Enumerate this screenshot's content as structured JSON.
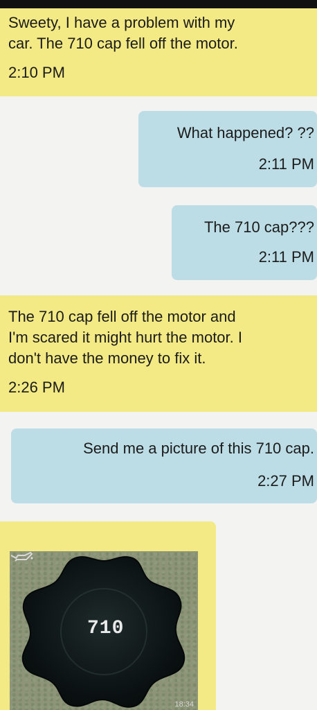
{
  "messages": [
    {
      "direction": "received",
      "text": "Sweety, I have a problem with my\ncar. The 710 cap fell off the motor.",
      "time": "2:10 PM"
    },
    {
      "direction": "sent",
      "text": "What happened? ??",
      "time": "2:11 PM"
    },
    {
      "direction": "sent",
      "text": "The 710 cap???",
      "time": "2:11 PM"
    },
    {
      "direction": "received",
      "text": "The 710 cap fell off the motor and\nI'm scared it might hurt the motor. I\ndon't have the money to fix it.",
      "time": "2:26 PM"
    },
    {
      "direction": "sent",
      "text": "Send me a picture of this 710 cap.",
      "time": "2:27 PM"
    }
  ],
  "photo": {
    "cap_marking": "OIL",
    "cap_marking_as_seen": "710",
    "timestamp": "18:34",
    "icon": "oil-can-icon"
  },
  "colors": {
    "received_bubble": "#f3ea85",
    "sent_bubble": "#bcdde6",
    "background": "#f3f3f1"
  }
}
